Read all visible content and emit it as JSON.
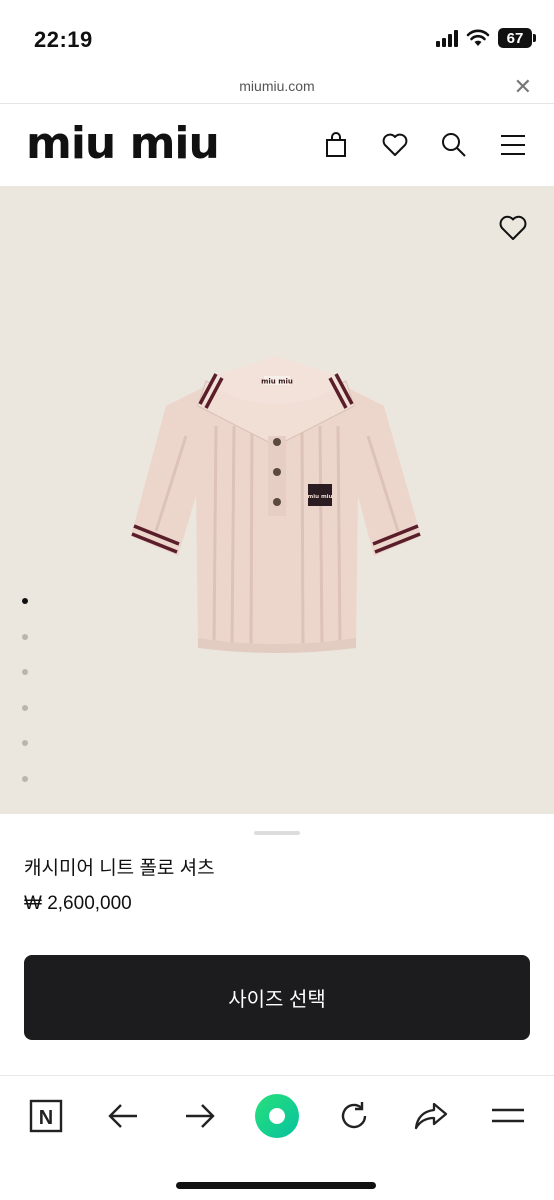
{
  "status": {
    "time": "22:19",
    "battery": "67"
  },
  "browser": {
    "url": "miumiu.com",
    "close_glyph": "✕"
  },
  "header": {
    "logo": "miu miu",
    "icons": [
      "bag-icon",
      "heart-icon",
      "search-icon",
      "menu-icon"
    ]
  },
  "gallery": {
    "dot_count": 6,
    "active_index": 0,
    "label_text": "miu miu",
    "badge_text": "miu miu",
    "colors": {
      "background": "#ebe7de",
      "shirt": "#ecd6cc",
      "stripe": "#5a1e2a"
    }
  },
  "product": {
    "name": "캐시미어 니트 폴로 셔츠",
    "price": "₩ 2,600,000",
    "cta": "사이즈 선택"
  },
  "bottom_bar": {
    "icons": [
      "naver-icon",
      "back-arrow-icon",
      "forward-arrow-icon",
      "green-home-icon",
      "refresh-icon",
      "share-icon",
      "menu-lines-icon"
    ],
    "naver_label": "N",
    "accent": "#19d36a"
  }
}
